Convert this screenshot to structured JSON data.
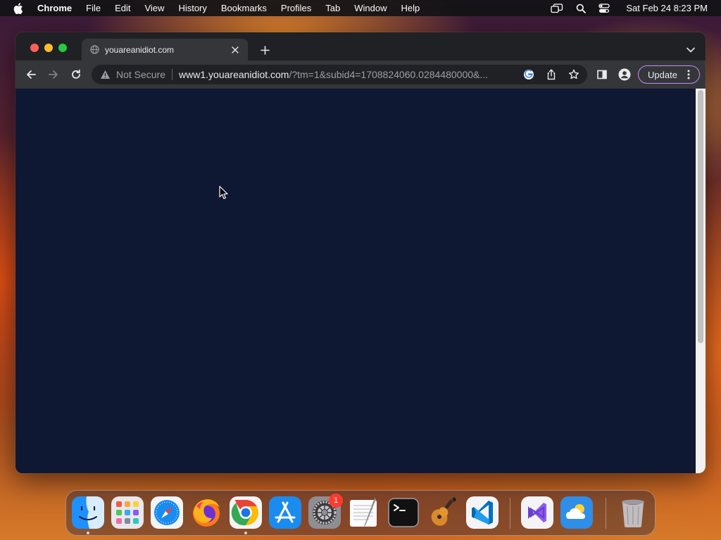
{
  "menubar": {
    "apple_icon": "apple-logo-icon",
    "items": [
      "Chrome",
      "File",
      "Edit",
      "View",
      "History",
      "Bookmarks",
      "Profiles",
      "Tab",
      "Window",
      "Help"
    ],
    "status_icons": [
      "screen-mirroring-icon",
      "spotlight-search-icon",
      "control-center-icon"
    ],
    "clock": "Sat Feb 24  8:23 PM"
  },
  "browser": {
    "tab": {
      "title": "youareanidiot.com",
      "favicon": "globe-icon"
    },
    "address_bar": {
      "security_label": "Not Secure",
      "url_host": "www1.youareanidiot.com",
      "url_rest": "/?tm=1&subid4=1708824060.0284480000&..."
    },
    "update_label": "Update",
    "content_background": "#0f1833"
  },
  "dock": {
    "apps": [
      {
        "name": "Finder",
        "running": true
      },
      {
        "name": "Launchpad",
        "running": false
      },
      {
        "name": "Safari",
        "running": false
      },
      {
        "name": "Firefox",
        "running": false
      },
      {
        "name": "Google Chrome",
        "running": true
      },
      {
        "name": "App Store",
        "running": false
      },
      {
        "name": "System Settings",
        "running": false,
        "badge": "1"
      },
      {
        "name": "TextEdit",
        "running": false
      },
      {
        "name": "Terminal",
        "running": false
      },
      {
        "name": "GarageBand",
        "running": false
      },
      {
        "name": "Visual Studio Code",
        "running": false
      },
      {
        "name": "Visual Studio",
        "running": false
      },
      {
        "name": "Weather",
        "running": false
      },
      {
        "name": "Trash",
        "running": false
      }
    ]
  }
}
